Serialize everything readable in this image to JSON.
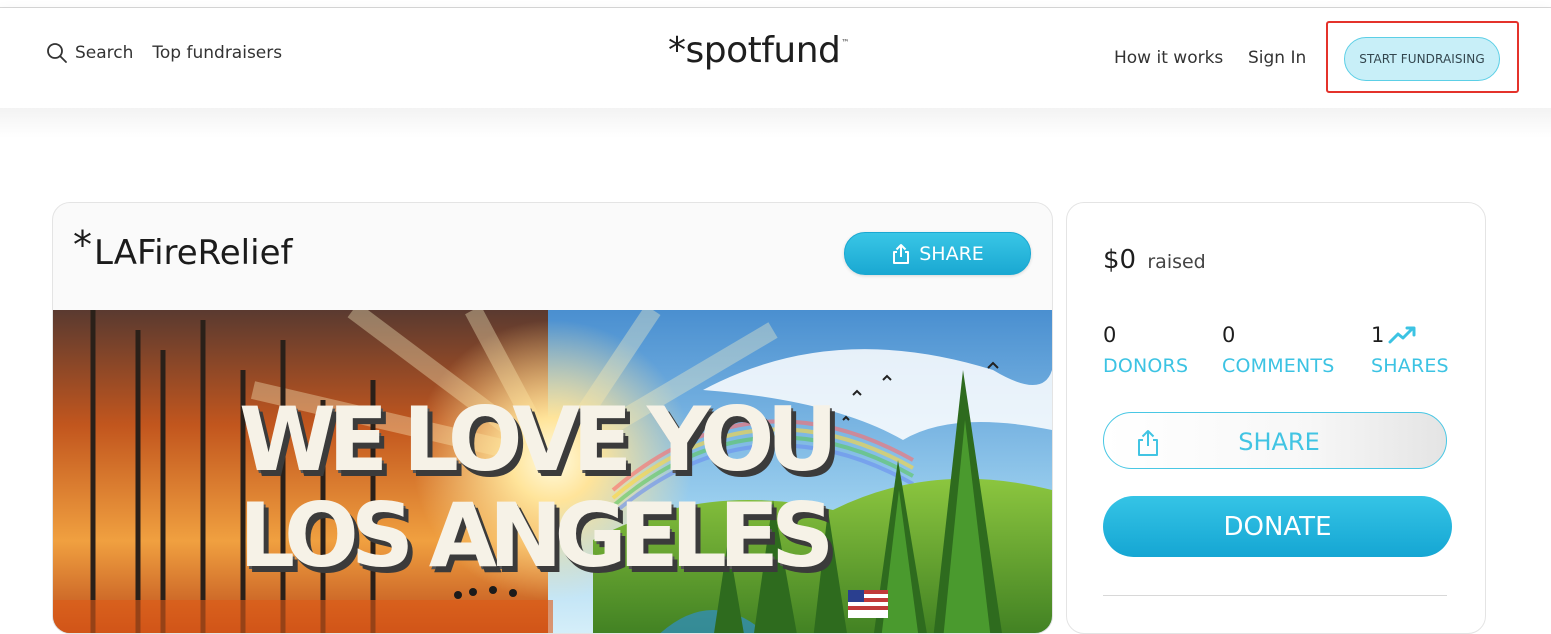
{
  "nav": {
    "search_label": "Search",
    "top_fundraisers": "Top fundraisers",
    "logo": "*spotfund",
    "logo_tm": "™",
    "how_it_works": "How it works",
    "sign_in": "Sign In",
    "start_fundraising": "START FUNDRAISING"
  },
  "campaign": {
    "asterisk": "*",
    "title": "LAFireRelief",
    "share_label": "SHARE",
    "hero_line1": "WE LOVE YOU",
    "hero_line2": "LOS ANGELES"
  },
  "sidebar": {
    "raised_amount": "$0",
    "raised_label": "raised",
    "donors_count": "0",
    "donors_label": "DONORS",
    "comments_count": "0",
    "comments_label": "COMMENTS",
    "shares_count": "1",
    "shares_label": "SHARES",
    "share_button": "SHARE",
    "donate_button": "DONATE"
  },
  "colors": {
    "accent": "#3cc3e3",
    "highlight": "#e4322b"
  }
}
